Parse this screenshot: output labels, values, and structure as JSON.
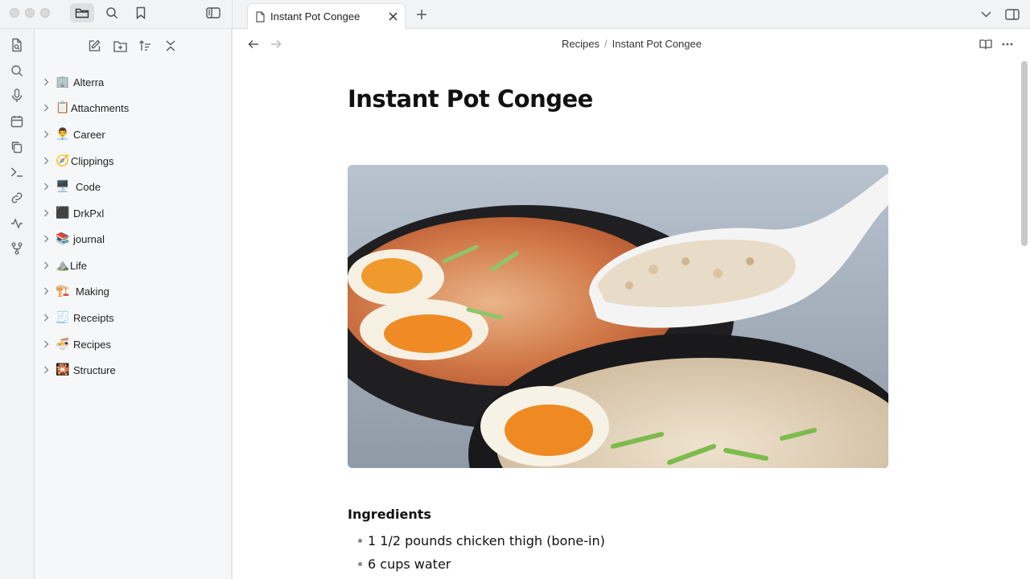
{
  "tab": {
    "title": "Instant Pot Congee"
  },
  "breadcrumb": {
    "parent": "Recipes",
    "separator": "/",
    "current": "Instant Pot Congee"
  },
  "sidebar": {
    "folders": [
      {
        "emoji": "🏢",
        "label": "Alterra"
      },
      {
        "emoji": "📋",
        "label": "Attachments"
      },
      {
        "emoji": "👨‍💼",
        "label": "Career"
      },
      {
        "emoji": "🧭",
        "label": "Clippings"
      },
      {
        "emoji": "🖥️",
        "label": "Code"
      },
      {
        "emoji": "⬛",
        "label": "DrkPxl"
      },
      {
        "emoji": "📚",
        "label": "journal"
      },
      {
        "emoji": "⛰️",
        "label": "Life"
      },
      {
        "emoji": "🏗️",
        "label": "Making"
      },
      {
        "emoji": "🧾",
        "label": "Receipts"
      },
      {
        "emoji": "🍜",
        "label": "Recipes"
      },
      {
        "emoji": "🎇",
        "label": "Structure"
      }
    ]
  },
  "note": {
    "title": "Instant Pot Congee",
    "section_heading": "Ingredients",
    "ingredients": [
      "1 1/2 pounds chicken thigh (bone-in)",
      "6 cups water"
    ]
  }
}
